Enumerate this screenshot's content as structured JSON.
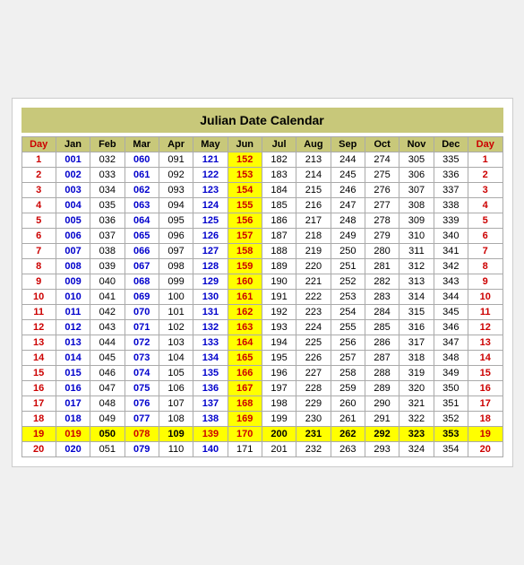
{
  "title": "Julian Date Calendar",
  "headers": [
    "Day",
    "Jan",
    "Feb",
    "Mar",
    "Apr",
    "May",
    "Jun",
    "Jul",
    "Aug",
    "Sep",
    "Oct",
    "Nov",
    "Dec",
    "Day"
  ],
  "rows": [
    {
      "day": 1,
      "vals": [
        "001",
        "032",
        "060",
        "091",
        "121",
        "152",
        "182",
        "213",
        "244",
        "274",
        "305",
        "335"
      ],
      "jun_yellow": true
    },
    {
      "day": 2,
      "vals": [
        "002",
        "033",
        "061",
        "092",
        "122",
        "153",
        "183",
        "214",
        "245",
        "275",
        "306",
        "336"
      ],
      "jun_yellow": true
    },
    {
      "day": 3,
      "vals": [
        "003",
        "034",
        "062",
        "093",
        "123",
        "154",
        "184",
        "215",
        "246",
        "276",
        "307",
        "337"
      ],
      "jun_yellow": true
    },
    {
      "day": 4,
      "vals": [
        "004",
        "035",
        "063",
        "094",
        "124",
        "155",
        "185",
        "216",
        "247",
        "277",
        "308",
        "338"
      ],
      "jun_yellow": true
    },
    {
      "day": 5,
      "vals": [
        "005",
        "036",
        "064",
        "095",
        "125",
        "156",
        "186",
        "217",
        "248",
        "278",
        "309",
        "339"
      ],
      "jun_yellow": true
    },
    {
      "day": 6,
      "vals": [
        "006",
        "037",
        "065",
        "096",
        "126",
        "157",
        "187",
        "218",
        "249",
        "279",
        "310",
        "340"
      ],
      "jun_yellow": true
    },
    {
      "day": 7,
      "vals": [
        "007",
        "038",
        "066",
        "097",
        "127",
        "158",
        "188",
        "219",
        "250",
        "280",
        "311",
        "341"
      ],
      "jun_yellow": true
    },
    {
      "day": 8,
      "vals": [
        "008",
        "039",
        "067",
        "098",
        "128",
        "159",
        "189",
        "220",
        "251",
        "281",
        "312",
        "342"
      ],
      "jun_yellow": true
    },
    {
      "day": 9,
      "vals": [
        "009",
        "040",
        "068",
        "099",
        "129",
        "160",
        "190",
        "221",
        "252",
        "282",
        "313",
        "343"
      ],
      "jun_yellow": true
    },
    {
      "day": 10,
      "vals": [
        "010",
        "041",
        "069",
        "100",
        "130",
        "161",
        "191",
        "222",
        "253",
        "283",
        "314",
        "344"
      ],
      "jun_yellow": true
    },
    {
      "day": 11,
      "vals": [
        "011",
        "042",
        "070",
        "101",
        "131",
        "162",
        "192",
        "223",
        "254",
        "284",
        "315",
        "345"
      ],
      "jun_yellow": true
    },
    {
      "day": 12,
      "vals": [
        "012",
        "043",
        "071",
        "102",
        "132",
        "163",
        "193",
        "224",
        "255",
        "285",
        "316",
        "346"
      ],
      "jun_yellow": true
    },
    {
      "day": 13,
      "vals": [
        "013",
        "044",
        "072",
        "103",
        "133",
        "164",
        "194",
        "225",
        "256",
        "286",
        "317",
        "347"
      ],
      "jun_yellow": true
    },
    {
      "day": 14,
      "vals": [
        "014",
        "045",
        "073",
        "104",
        "134",
        "165",
        "195",
        "226",
        "257",
        "287",
        "318",
        "348"
      ],
      "jun_yellow": true
    },
    {
      "day": 15,
      "vals": [
        "015",
        "046",
        "074",
        "105",
        "135",
        "166",
        "196",
        "227",
        "258",
        "288",
        "319",
        "349"
      ],
      "jun_yellow": true
    },
    {
      "day": 16,
      "vals": [
        "016",
        "047",
        "075",
        "106",
        "136",
        "167",
        "197",
        "228",
        "259",
        "289",
        "320",
        "350"
      ],
      "jun_yellow": true
    },
    {
      "day": 17,
      "vals": [
        "017",
        "048",
        "076",
        "107",
        "137",
        "168",
        "198",
        "229",
        "260",
        "290",
        "321",
        "351"
      ],
      "jun_yellow": true
    },
    {
      "day": 18,
      "vals": [
        "018",
        "049",
        "077",
        "108",
        "138",
        "169",
        "199",
        "230",
        "261",
        "291",
        "322",
        "352"
      ],
      "jun_yellow": true
    },
    {
      "day": 19,
      "vals": [
        "019",
        "050",
        "078",
        "109",
        "139",
        "170",
        "200",
        "231",
        "262",
        "292",
        "323",
        "353"
      ],
      "jun_yellow": true,
      "row_yellow": true
    },
    {
      "day": 20,
      "vals": [
        "020",
        "051",
        "079",
        "110",
        "140",
        "171",
        "201",
        "232",
        "263",
        "293",
        "324",
        "354"
      ],
      "jun_yellow": false
    }
  ],
  "colors": {
    "header_bg": "#c8c87a",
    "yellow": "#ffff00",
    "red": "#cc0000",
    "blue": "#0000cc"
  }
}
